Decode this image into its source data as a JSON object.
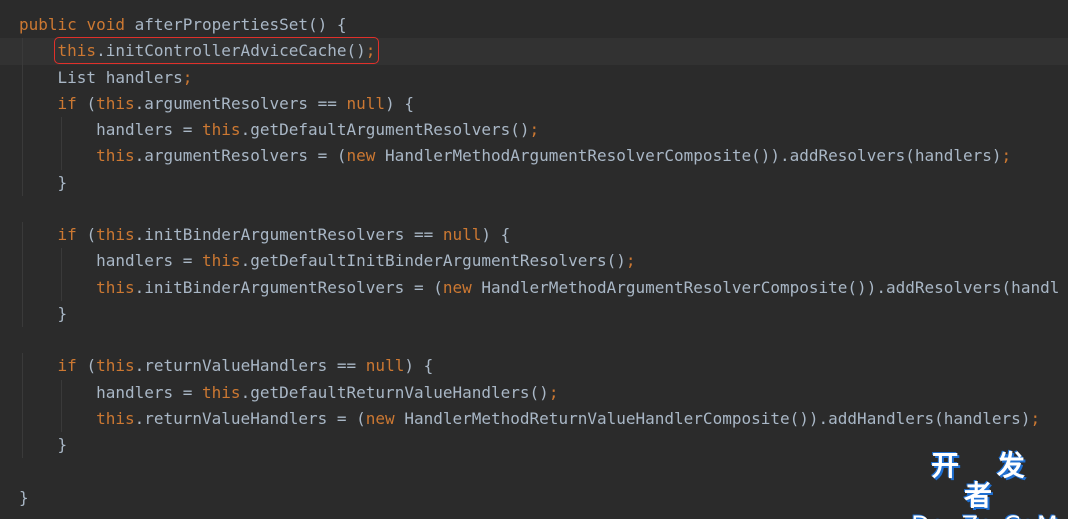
{
  "code_lines": [
    {
      "indent": 0,
      "tokens": [
        {
          "t": "public ",
          "c": "kw"
        },
        {
          "t": "void ",
          "c": "kw"
        },
        {
          "t": "afterPropertiesSet() {",
          "c": "id"
        }
      ]
    },
    {
      "indent": 1,
      "current": true,
      "boxed": true,
      "tokens": [
        {
          "t": "this",
          "c": "kw"
        },
        {
          "t": ".initControllerAdviceCache()",
          "c": "id"
        },
        {
          "t": ";",
          "c": "kw"
        }
      ]
    },
    {
      "indent": 1,
      "tokens": [
        {
          "t": "List handlers",
          "c": "id"
        },
        {
          "t": ";",
          "c": "kw"
        }
      ]
    },
    {
      "indent": 1,
      "tokens": [
        {
          "t": "if ",
          "c": "kw"
        },
        {
          "t": "(",
          "c": "id"
        },
        {
          "t": "this",
          "c": "kw"
        },
        {
          "t": ".argumentResolvers == ",
          "c": "id"
        },
        {
          "t": "null",
          "c": "kw"
        },
        {
          "t": ") {",
          "c": "id"
        }
      ]
    },
    {
      "indent": 2,
      "tokens": [
        {
          "t": "handlers = ",
          "c": "id"
        },
        {
          "t": "this",
          "c": "kw"
        },
        {
          "t": ".getDefaultArgumentResolvers()",
          "c": "id"
        },
        {
          "t": ";",
          "c": "kw"
        }
      ]
    },
    {
      "indent": 2,
      "tokens": [
        {
          "t": "this",
          "c": "kw"
        },
        {
          "t": ".argumentResolvers = (",
          "c": "id"
        },
        {
          "t": "new ",
          "c": "kw"
        },
        {
          "t": "HandlerMethodArgumentResolverComposite()).addResolvers(handlers)",
          "c": "id"
        },
        {
          "t": ";",
          "c": "kw"
        }
      ]
    },
    {
      "indent": 1,
      "tokens": [
        {
          "t": "}",
          "c": "id"
        }
      ]
    },
    {
      "indent": 0,
      "tokens": []
    },
    {
      "indent": 1,
      "tokens": [
        {
          "t": "if ",
          "c": "kw"
        },
        {
          "t": "(",
          "c": "id"
        },
        {
          "t": "this",
          "c": "kw"
        },
        {
          "t": ".initBinderArgumentResolvers == ",
          "c": "id"
        },
        {
          "t": "null",
          "c": "kw"
        },
        {
          "t": ") {",
          "c": "id"
        }
      ]
    },
    {
      "indent": 2,
      "tokens": [
        {
          "t": "handlers = ",
          "c": "id"
        },
        {
          "t": "this",
          "c": "kw"
        },
        {
          "t": ".getDefaultInitBinderArgumentResolvers()",
          "c": "id"
        },
        {
          "t": ";",
          "c": "kw"
        }
      ]
    },
    {
      "indent": 2,
      "tokens": [
        {
          "t": "this",
          "c": "kw"
        },
        {
          "t": ".initBinderArgumentResolvers = (",
          "c": "id"
        },
        {
          "t": "new ",
          "c": "kw"
        },
        {
          "t": "HandlerMethodArgumentResolverComposite()).addResolvers(handl",
          "c": "id"
        }
      ]
    },
    {
      "indent": 1,
      "tokens": [
        {
          "t": "}",
          "c": "id"
        }
      ]
    },
    {
      "indent": 0,
      "tokens": []
    },
    {
      "indent": 1,
      "tokens": [
        {
          "t": "if ",
          "c": "kw"
        },
        {
          "t": "(",
          "c": "id"
        },
        {
          "t": "this",
          "c": "kw"
        },
        {
          "t": ".returnValueHandlers == ",
          "c": "id"
        },
        {
          "t": "null",
          "c": "kw"
        },
        {
          "t": ") {",
          "c": "id"
        }
      ]
    },
    {
      "indent": 2,
      "tokens": [
        {
          "t": "handlers = ",
          "c": "id"
        },
        {
          "t": "this",
          "c": "kw"
        },
        {
          "t": ".getDefaultReturnValueHandlers()",
          "c": "id"
        },
        {
          "t": ";",
          "c": "kw"
        }
      ]
    },
    {
      "indent": 2,
      "tokens": [
        {
          "t": "this",
          "c": "kw"
        },
        {
          "t": ".returnValueHandlers = (",
          "c": "id"
        },
        {
          "t": "new ",
          "c": "kw"
        },
        {
          "t": "HandlerMethodReturnValueHandlerComposite()).addHandlers(handlers)",
          "c": "id"
        },
        {
          "t": ";",
          "c": "kw"
        }
      ]
    },
    {
      "indent": 1,
      "tokens": [
        {
          "t": "}",
          "c": "id"
        }
      ]
    },
    {
      "indent": 0,
      "tokens": []
    },
    {
      "indent": 0,
      "tokens": [
        {
          "t": "}",
          "c": "id"
        }
      ]
    }
  ],
  "colors": {
    "background": "#2b2b2b",
    "keyword": "#cc7832",
    "identifier": "#a9b7c6",
    "highlight_box": "#e0302a"
  },
  "watermark": {
    "line1": "开 发 者",
    "line2": "DevZe.CoM"
  }
}
